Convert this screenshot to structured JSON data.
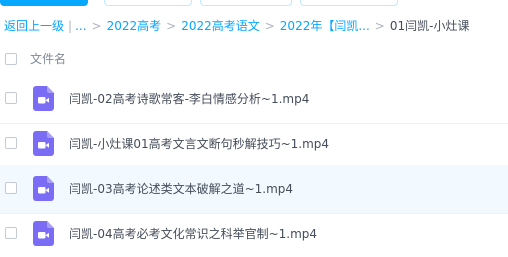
{
  "breadcrumb": {
    "back": "返回上一级",
    "ellipsis": "...",
    "items": [
      "2022高考",
      "2022高考语文",
      "2022年【闫凯..."
    ],
    "current": "01闫凯-小灶课"
  },
  "list_header": {
    "name_column": "文件名"
  },
  "files": [
    {
      "name": "闫凯-02高考诗歌常客-李白情感分析~1.mp4",
      "type": "video-file-icon"
    },
    {
      "name": "闫凯-小灶课01高考文言文断句秒解技巧~1.mp4",
      "type": "video-file-icon"
    },
    {
      "name": "闫凯-03高考论述类文本破解之道~1.mp4",
      "type": "video-file-icon"
    },
    {
      "name": "闫凯-04高考必考文化常识之科举官制~1.mp4",
      "type": "video-file-icon"
    }
  ],
  "colors": {
    "accent": "#06a7ff",
    "video_icon": "#7b6cf6",
    "hover_row": "#f2faff"
  }
}
